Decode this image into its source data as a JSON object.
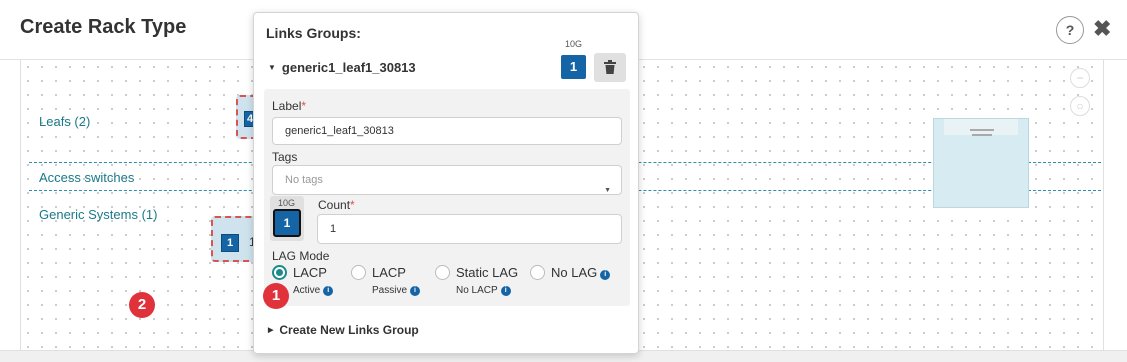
{
  "header": {
    "title": "Create Rack Type",
    "help": "?",
    "close": "✖"
  },
  "canvas": {
    "rows": [
      {
        "label": "Leafs (2)"
      },
      {
        "label": "Access switches"
      },
      {
        "label": "Generic Systems (1)"
      }
    ],
    "leaf_node_badge": "4",
    "generic_node_badge": "1",
    "generic_node_text": "1"
  },
  "step_badges": [
    "1",
    "2"
  ],
  "popover": {
    "title": "Links Groups:",
    "speed": "10G",
    "group_name": "generic1_leaf1_30813",
    "count_badge": "1",
    "form": {
      "label_field": {
        "label": "Label",
        "value": "generic1_leaf1_30813"
      },
      "tags_field": {
        "label": "Tags",
        "placeholder": "No tags"
      },
      "port": {
        "speed": "10G",
        "value": "1"
      },
      "count_field": {
        "label": "Count",
        "value": "1"
      },
      "lag_mode": {
        "label": "LAG Mode",
        "options": [
          {
            "label": "LACP",
            "sub": "Active",
            "selected": true
          },
          {
            "label": "LACP",
            "sub": "Passive",
            "selected": false
          },
          {
            "label": "Static LAG",
            "sub": "No LACP",
            "selected": false
          },
          {
            "label": "No LAG",
            "sub": "",
            "selected": false
          }
        ]
      }
    },
    "create_link": "Create New Links Group"
  },
  "colors": {
    "accent": "#1565a6",
    "teal": "#1a8a8a",
    "danger": "#e0323a"
  }
}
